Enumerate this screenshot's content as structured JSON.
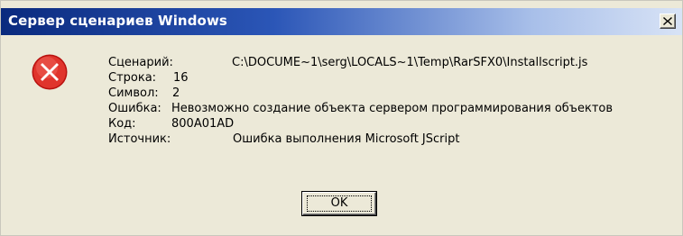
{
  "window": {
    "title": "Сервер сценариев Windows",
    "close_glyph": "x"
  },
  "icon": {
    "name": "error-icon",
    "color": "#d9231e"
  },
  "details": {
    "script_label": "Сценарий:",
    "script_value": "C:\\DOCUME~1\\serg\\LOCALS~1\\Temp\\RarSFX0\\Installscript.js",
    "line_label": "Строка:",
    "line_value": "16",
    "char_label": "Символ:",
    "char_value": "2",
    "error_label": "Ошибка:",
    "error_value": "Невозможно создание объекта сервером программирования объектов",
    "code_label": "Код:",
    "code_value": "800A01AD",
    "source_label": "Источник:",
    "source_value": "Ошибка выполнения Microsoft JScript"
  },
  "buttons": {
    "ok_label": "OK"
  }
}
